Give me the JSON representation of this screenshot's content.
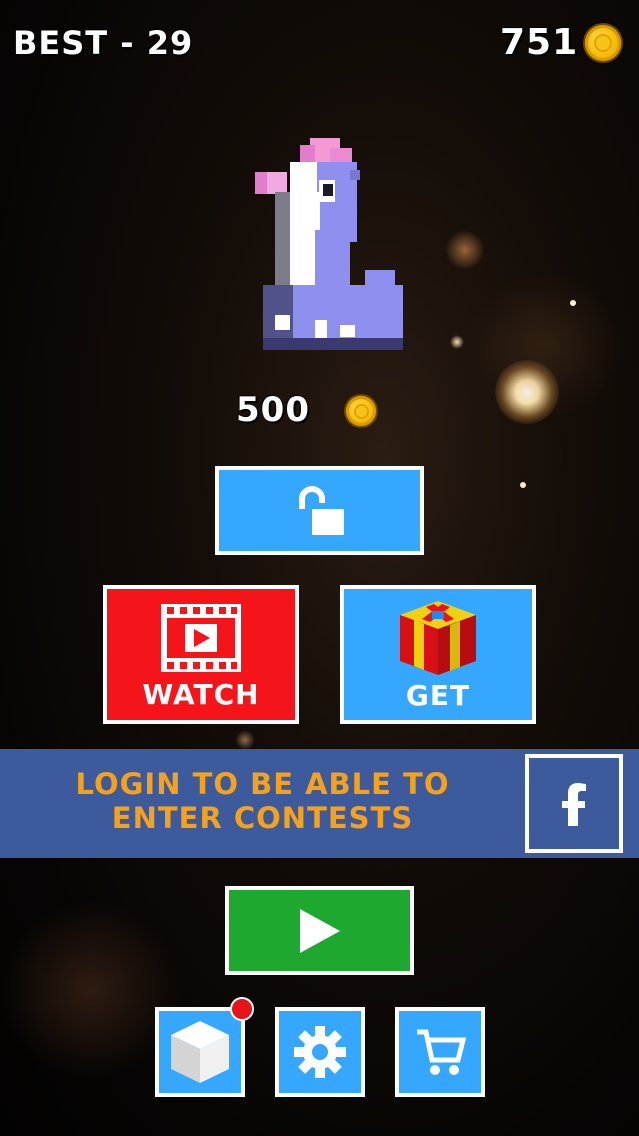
{
  "hud": {
    "best_label": "BEST - 29",
    "coins": "751"
  },
  "character": {
    "price": "500"
  },
  "buttons": {
    "unlock_icon": "unlock-icon",
    "watch_label": "WATCH",
    "get_label": "GET",
    "play_icon": "play-icon",
    "cube_icon": "cube-icon",
    "settings_icon": "gear-icon",
    "cart_icon": "cart-icon"
  },
  "login_banner": {
    "line1": "LOGIN TO BE ABLE TO",
    "line2": "ENTER CONTESTS",
    "facebook_icon": "facebook-icon"
  },
  "colors": {
    "blue_button": "#35a7ff",
    "red_button": "#f5141a",
    "green_button": "#1ea830",
    "banner": "#3d5b9c",
    "banner_text": "#f5a21a",
    "coin": "#f5b800",
    "notification": "#e8141a"
  }
}
